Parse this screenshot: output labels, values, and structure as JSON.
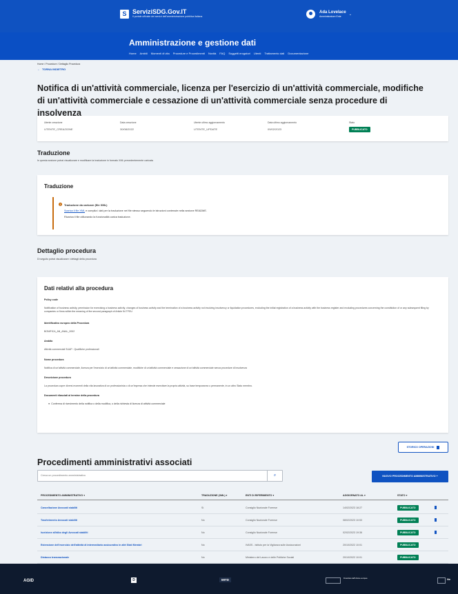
{
  "header": {
    "brand_title": "ServiziSDG.Gov.IT",
    "brand_subtitle": "Il portale ufficiale dei servizi dell'amministrazione pubblica italiana",
    "user_name": "Ada Lovelace",
    "user_role": "Amministratore Ente",
    "app_title": "Amministrazione e gestione dati",
    "menu": [
      "Home",
      "Ambiti",
      "Momenti di vita",
      "Procedure e Procedimenti",
      "Novità",
      "FAQ",
      "Soggetti erogatori",
      "Utenti",
      "Trattamento dati",
      "Documentazione"
    ]
  },
  "breadcrumb": "Home / Procedure / Dettaglio Procedura",
  "back_label": "TORNA INDIETRO",
  "page_title": "Notifica di un'attività commerciale, licenza per l'esercizio di un'attività commerciale, modifiche di un'attività commerciale e cessazione di un'attività commerciale senza procedure di insolvenza",
  "meta": [
    {
      "label": "Utente creazione",
      "value": "UTENTE_CREAZIONE"
    },
    {
      "label": "Data creazione",
      "value": "30/08/2022"
    },
    {
      "label": "Utente ultimo aggiornamento",
      "value": "UTENTE_UPDATE"
    },
    {
      "label": "Data ultimo aggiornamento",
      "value": "09/02/2023"
    },
    {
      "label": "Stato",
      "value": "PUBBLICATO"
    }
  ],
  "translation": {
    "title": "Traduzione",
    "subtitle": "In questa sezione potrai visualizzare e modificare la traduzione in formato XML precedentemente caricata",
    "card_title": "Traduzione",
    "callout_title": "Traduzione da caricare (file XML)",
    "callout_link": "Scarica il file XML",
    "callout_text": "e compila i dati per la traduzione nel file stesso seguendo le istruzioni contenute nella sezione README.",
    "callout_text2": "Ricarica il file utilizzando la funzionalità carica traduzione."
  },
  "detail": {
    "title": "Dettaglio procedura",
    "subtitle": "Di seguito potrai visualizzare i dettagli della procedura",
    "card_title": "Dati relativi alla procedura",
    "policy_label": "Policy code",
    "policy_value": "Notification of business activity, permission for exercising a business activity, changes of business activity and the termination of a business activity not involving insolvency or liquidation procedures, excluding the initial registration of a business activity with the business register and excluding procedures concerning the constitution of or any subsequent filing by companies or firms within the meaning of the second paragraph of Article 54 TFEU",
    "eu_id_label": "Identificativo europeo della Procedura",
    "eu_id_value": "BONIFICA_AN_ANAL_0002",
    "ambito_label": "Ambito",
    "ambito_value": "Attività commerciali SUAP : Qualifiche professionali",
    "nome_label": "Nome procedura",
    "nome_value": "Notifica di un'attività commerciale, licenza per l'esercizio di un'attività commerciale, modifiche di un'attività commerciale e cessazione di un'attività commerciale senza procedure di insolvenza",
    "desc_label": "Descrizione procedura",
    "desc_value": "La procedura copre diversi momenti della vita lavorativa di un professionista o di un'impresa che intende esercitare la propria attività, su base temporanea o permanente, in un altro Stato membro.",
    "docs_label": "Documenti rilasciati al termine della procedura",
    "docs": [
      "Conferma di ricevimento della notifica o della modifica, o della richiesta di licenza di attività commerciale"
    ]
  },
  "storico_label": "STORICO OPERAZIONI",
  "procedimenti": {
    "title": "Procedimenti amministrativi associati",
    "search_placeholder": "Cerca un procedimento amministrativo",
    "new_button": "NUOVO PROCEDIMENTO AMMINISTRATIVO +",
    "columns": [
      "PROCEDIMENTO AMMINISTRATIVO",
      "TRADUZIONE (XML)",
      "ENTI DI RIFERIMENTO",
      "AGGIORNATO AL",
      "STATO"
    ],
    "rows": [
      {
        "name": "Cancellazione Avvocati stabiliti",
        "xml": "Sì",
        "ente": "Consiglio Nazionale Forense",
        "date": "14/02/2023 18:27",
        "stato": "PUBBLICATO",
        "trash": true
      },
      {
        "name": "Trasferimento Avvocati stabiliti",
        "xml": "No",
        "ente": "Consiglio Nazionale Forense",
        "date": "08/02/2023 10:53",
        "stato": "PUBBLICATO",
        "trash": true
      },
      {
        "name": "Iscrizione all'albo degli Avvocati stabiliti",
        "xml": "No",
        "ente": "Consiglio Nazionale Forense",
        "date": "02/02/2023 19:36",
        "stato": "PUBBLICATO",
        "trash": true
      },
      {
        "name": "Estensione dell'esercizio dell'attività di intermediario assicurativo in altri Stati Membri",
        "xml": "No",
        "ente": "IVASS - Istituto per la Vigilanza sulle Assicurazioni",
        "date": "20/10/2022 10:01",
        "stato": "PUBBLICATO",
        "trash": false
      },
      {
        "name": "Distacco transnazionale",
        "xml": "No",
        "ente": "Ministero del Lavoro e delle Politiche Sociali",
        "date": "20/10/2022 10:01",
        "stato": "PUBBLICATO",
        "trash": false
      }
    ]
  },
  "footer": {
    "agid": "AGID",
    "mitd": "MITD",
    "eu_text": "Finanziato dall'Unione europea",
    "next": "Ne"
  },
  "colors": {
    "primary": "#0f52c1",
    "success": "#008055",
    "warning": "#c76b0c",
    "footer": "#0e1a2e"
  }
}
